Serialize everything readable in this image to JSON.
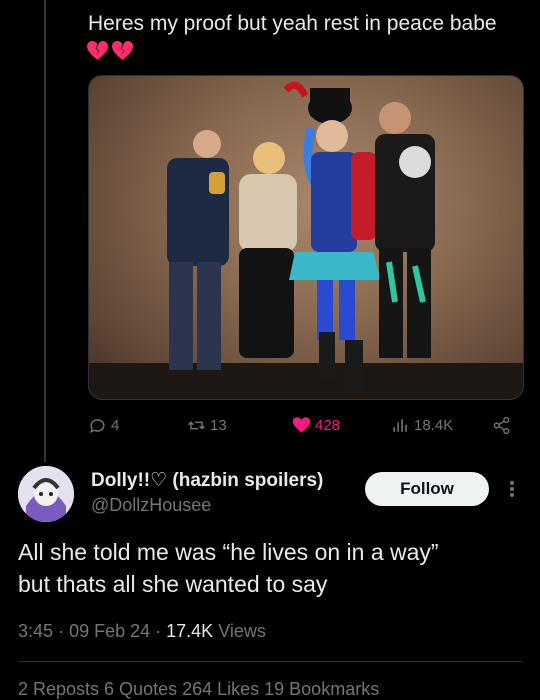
{
  "previous_tweet": {
    "text": "Heres my proof but yeah rest in peace babe",
    "emoji": "💔💔",
    "actions": {
      "replies": "4",
      "retweets": "13",
      "likes": "428",
      "views": "18.4K"
    }
  },
  "tweet": {
    "display_name": "Dolly!!♡ (hazbin spoilers)",
    "handle": "@DollzHousee",
    "follow_label": "Follow",
    "text_line1": "All she told me was “he lives on in a way”",
    "text_line2": "but thats all she wanted to say",
    "time": "3:45",
    "date": "09 Feb 24",
    "views_count": "17.4K",
    "views_label": "Views",
    "stats_text": "2 Reposts   6 Quotes   264 Likes   19 Bookmarks"
  },
  "colors": {
    "background": "#000000",
    "text": "#e7e9ea",
    "muted": "#71767b",
    "like": "#f91880",
    "heart_broken": "#ff2d6b"
  }
}
